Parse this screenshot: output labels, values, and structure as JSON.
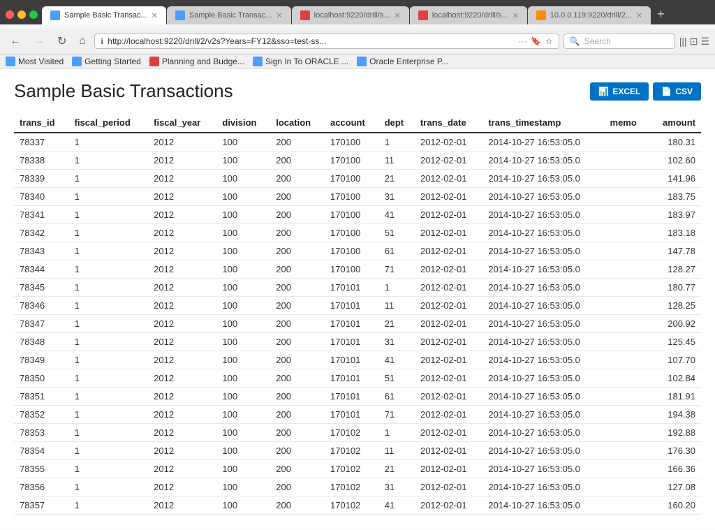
{
  "browser": {
    "tabs": [
      {
        "label": "Sample Basic Transac...",
        "favicon_color": "blue",
        "active": true,
        "closeable": true
      },
      {
        "label": "Sample Basic Transac...",
        "favicon_color": "blue",
        "active": false,
        "closeable": true
      },
      {
        "label": "localhost:9220/drill/s...",
        "favicon_color": "red",
        "active": false,
        "closeable": true
      },
      {
        "label": "localhost:9220/drill/s...",
        "favicon_color": "red",
        "active": false,
        "closeable": true
      },
      {
        "label": "10.0.0.119:9220/drill/2...",
        "favicon_color": "orange",
        "active": false,
        "closeable": true
      }
    ],
    "url": "http://localhost:9220/drill/2/v2s?Years=FY12&sso=test-ss...",
    "search_placeholder": "Search"
  },
  "bookmarks": [
    {
      "label": "Most Visited",
      "icon_color": "blue"
    },
    {
      "label": "Getting Started",
      "icon_color": "blue"
    },
    {
      "label": "Planning and Budge...",
      "icon_color": "red"
    },
    {
      "label": "Sign In To ORACLE ...",
      "icon_color": "blue"
    },
    {
      "label": "Oracle Enterprise P...",
      "icon_color": "blue"
    }
  ],
  "page": {
    "title": "Sample Basic Transactions",
    "export_buttons": [
      {
        "label": "EXCEL",
        "icon": "📊"
      },
      {
        "label": "CSV",
        "icon": "📄"
      }
    ]
  },
  "table": {
    "columns": [
      "trans_id",
      "fiscal_period",
      "fiscal_year",
      "division",
      "location",
      "account",
      "dept",
      "trans_date",
      "trans_timestamp",
      "memo",
      "amount"
    ],
    "rows": [
      [
        78337,
        1,
        2012,
        100,
        200,
        170100,
        1,
        "2012-02-01",
        "2014-10-27 16:53:05.0",
        "",
        "180.31"
      ],
      [
        78338,
        1,
        2012,
        100,
        200,
        170100,
        11,
        "2012-02-01",
        "2014-10-27 16:53:05.0",
        "",
        "102.60"
      ],
      [
        78339,
        1,
        2012,
        100,
        200,
        170100,
        21,
        "2012-02-01",
        "2014-10-27 16:53:05.0",
        "",
        "141.96"
      ],
      [
        78340,
        1,
        2012,
        100,
        200,
        170100,
        31,
        "2012-02-01",
        "2014-10-27 16:53:05.0",
        "",
        "183.75"
      ],
      [
        78341,
        1,
        2012,
        100,
        200,
        170100,
        41,
        "2012-02-01",
        "2014-10-27 16:53:05.0",
        "",
        "183.97"
      ],
      [
        78342,
        1,
        2012,
        100,
        200,
        170100,
        51,
        "2012-02-01",
        "2014-10-27 16:53:05.0",
        "",
        "183.18"
      ],
      [
        78343,
        1,
        2012,
        100,
        200,
        170100,
        61,
        "2012-02-01",
        "2014-10-27 16:53:05.0",
        "",
        "147.78"
      ],
      [
        78344,
        1,
        2012,
        100,
        200,
        170100,
        71,
        "2012-02-01",
        "2014-10-27 16:53:05.0",
        "",
        "128.27"
      ],
      [
        78345,
        1,
        2012,
        100,
        200,
        170101,
        1,
        "2012-02-01",
        "2014-10-27 16:53:05.0",
        "",
        "180.77"
      ],
      [
        78346,
        1,
        2012,
        100,
        200,
        170101,
        11,
        "2012-02-01",
        "2014-10-27 16:53:05.0",
        "",
        "128.25"
      ],
      [
        78347,
        1,
        2012,
        100,
        200,
        170101,
        21,
        "2012-02-01",
        "2014-10-27 16:53:05.0",
        "",
        "200.92"
      ],
      [
        78348,
        1,
        2012,
        100,
        200,
        170101,
        31,
        "2012-02-01",
        "2014-10-27 16:53:05.0",
        "",
        "125.45"
      ],
      [
        78349,
        1,
        2012,
        100,
        200,
        170101,
        41,
        "2012-02-01",
        "2014-10-27 16:53:05.0",
        "",
        "107.70"
      ],
      [
        78350,
        1,
        2012,
        100,
        200,
        170101,
        51,
        "2012-02-01",
        "2014-10-27 16:53:05.0",
        "",
        "102.84"
      ],
      [
        78351,
        1,
        2012,
        100,
        200,
        170101,
        61,
        "2012-02-01",
        "2014-10-27 16:53:05.0",
        "",
        "181.91"
      ],
      [
        78352,
        1,
        2012,
        100,
        200,
        170101,
        71,
        "2012-02-01",
        "2014-10-27 16:53:05.0",
        "",
        "194.38"
      ],
      [
        78353,
        1,
        2012,
        100,
        200,
        170102,
        1,
        "2012-02-01",
        "2014-10-27 16:53:05.0",
        "",
        "192.88"
      ],
      [
        78354,
        1,
        2012,
        100,
        200,
        170102,
        11,
        "2012-02-01",
        "2014-10-27 16:53:05.0",
        "",
        "176.30"
      ],
      [
        78355,
        1,
        2012,
        100,
        200,
        170102,
        21,
        "2012-02-01",
        "2014-10-27 16:53:05.0",
        "",
        "166.36"
      ],
      [
        78356,
        1,
        2012,
        100,
        200,
        170102,
        31,
        "2012-02-01",
        "2014-10-27 16:53:05.0",
        "",
        "127.08"
      ],
      [
        78357,
        1,
        2012,
        100,
        200,
        170102,
        41,
        "2012-02-01",
        "2014-10-27 16:53:05.0",
        "",
        "160.20"
      ]
    ]
  },
  "colors": {
    "excel_btn": "#0072c6",
    "csv_btn": "#0072c6"
  }
}
